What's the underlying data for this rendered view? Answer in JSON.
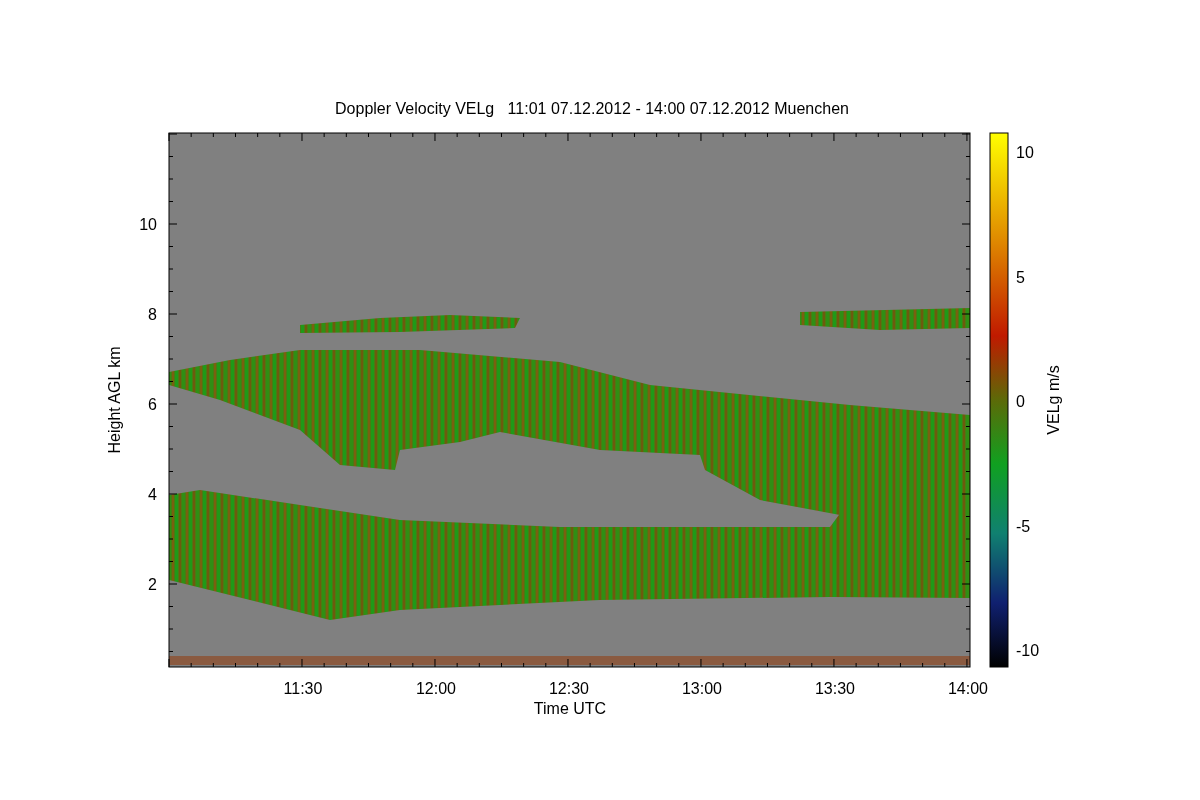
{
  "chart": {
    "title": "Doppler Velocity VELg   11:01 07.12.2012 - 14:00 07.12.2012 Muenchen",
    "xlabel": "Time UTC",
    "ylabel": "Height AGL km",
    "xticks": [
      "11:30",
      "12:00",
      "12:30",
      "13:00",
      "13:30",
      "14:00"
    ],
    "yticks": [
      "10",
      "8",
      "6",
      "4",
      "2"
    ],
    "colorbar": {
      "label": "VELg m/s",
      "ticks": [
        "10",
        "5",
        "0",
        "-5",
        "-10"
      ]
    }
  }
}
